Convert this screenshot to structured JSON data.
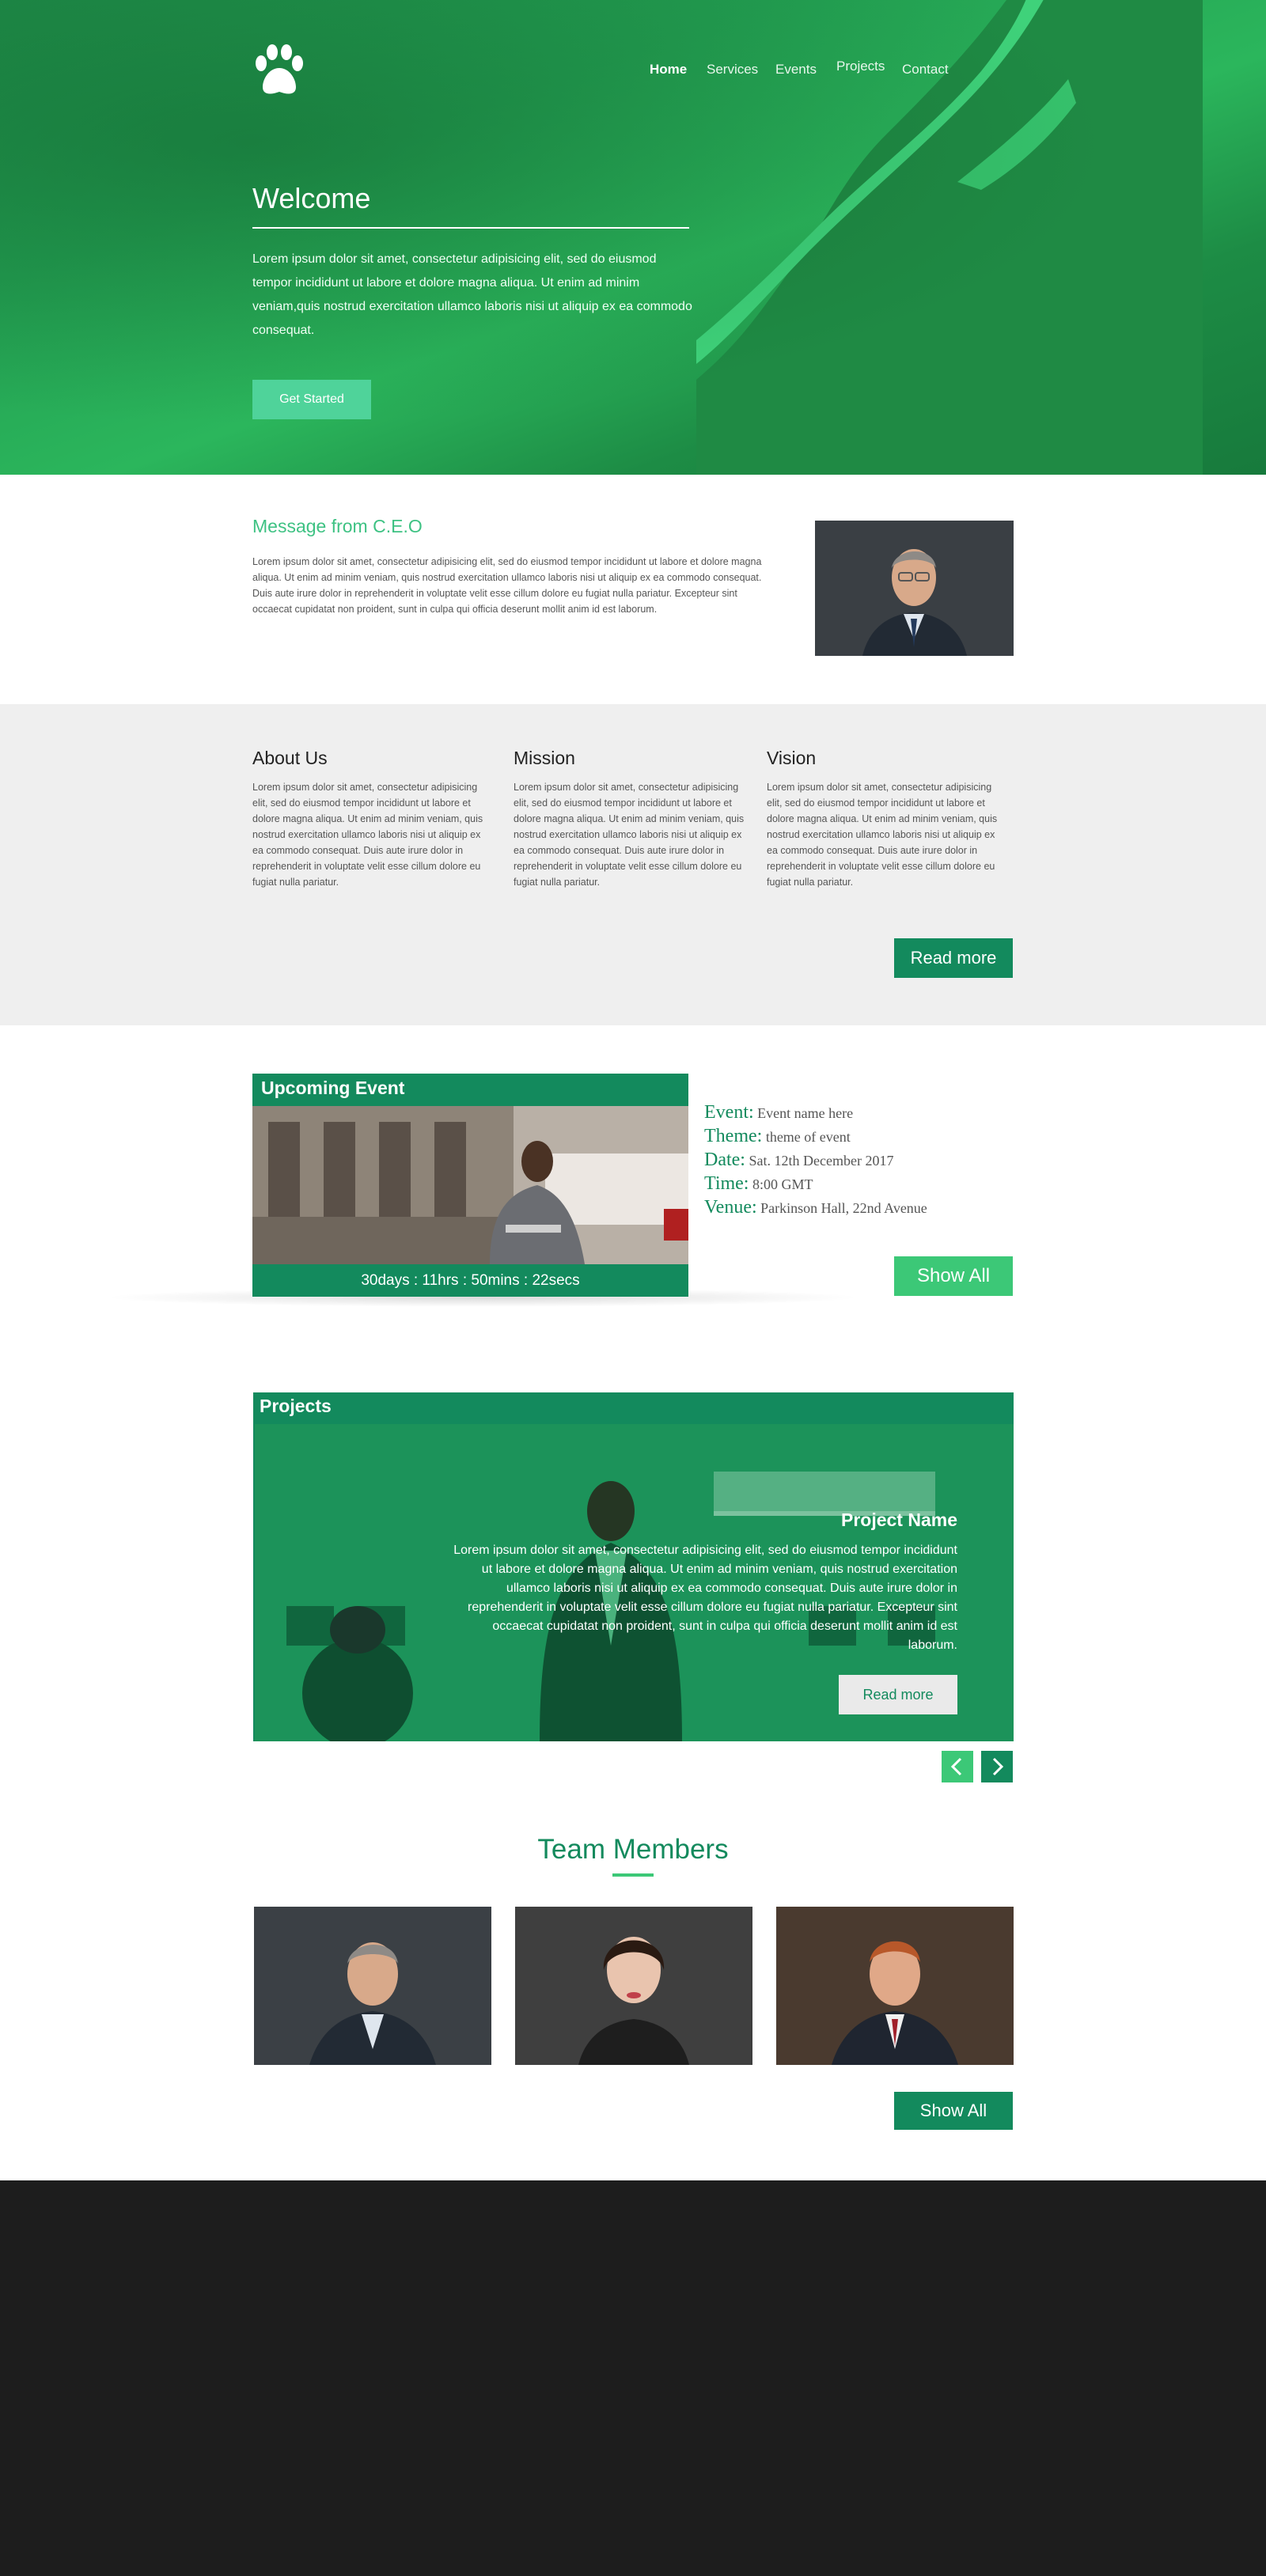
{
  "header": {
    "nav": [
      "Home",
      "Services",
      "Events",
      "Projects",
      "Contact"
    ]
  },
  "hero": {
    "title": "Welcome",
    "text": "Lorem ipsum dolor sit amet, consectetur adipisicing elit, sed do eiusmod tempor incididunt ut labore et dolore magna aliqua. Ut enim ad minim veniam,quis nostrud exercitation ullamco laboris nisi ut aliquip ex ea commodo consequat.",
    "button": "Get Started"
  },
  "ceo": {
    "title": "Message from C.E.O",
    "text": "Lorem ipsum dolor sit amet, consectetur adipisicing elit, sed do eiusmod tempor incididunt ut labore et dolore magna aliqua. Ut enim ad minim veniam, quis nostrud exercitation ullamco laboris nisi ut aliquip ex ea commodo consequat. Duis aute irure dolor in reprehenderit in voluptate velit esse cillum dolore eu fugiat nulla pariatur. Excepteur sint occaecat cupidatat non proident, sunt in culpa qui officia deserunt mollit anim id est laborum."
  },
  "about": {
    "columns": [
      {
        "title": "About Us",
        "text": "Lorem ipsum dolor sit amet, consectetur adipisicing elit, sed do eiusmod tempor incididunt ut labore et dolore magna aliqua. Ut enim ad minim veniam, quis nostrud exercitation ullamco laboris nisi ut aliquip ex ea commodo consequat. Duis aute irure dolor in reprehenderit in voluptate velit esse cillum dolore eu fugiat nulla pariatur."
      },
      {
        "title": "Mission",
        "text": "Lorem ipsum dolor sit amet, consectetur adipisicing elit, sed do eiusmod tempor incididunt ut labore et dolore magna aliqua. Ut enim ad minim veniam, quis nostrud exercitation ullamco laboris nisi ut aliquip ex ea commodo consequat. Duis aute irure dolor in reprehenderit in voluptate velit esse cillum dolore eu fugiat nulla pariatur."
      },
      {
        "title": "Vision",
        "text": "Lorem ipsum dolor sit amet, consectetur adipisicing elit, sed do eiusmod tempor incididunt ut labore et dolore magna aliqua. Ut enim ad minim veniam, quis nostrud exercitation ullamco laboris nisi ut aliquip ex ea commodo consequat. Duis aute irure dolor in reprehenderit in voluptate velit esse cillum dolore eu fugiat nulla pariatur."
      }
    ],
    "button": "Read more"
  },
  "event": {
    "heading": "Upcoming Event",
    "countdown": "30days : 11hrs : 50mins : 22secs",
    "details": [
      {
        "key": "Event:",
        "value": "Event name here"
      },
      {
        "key": "Theme:",
        "value": "theme of event"
      },
      {
        "key": "Date:",
        "value": "Sat. 12th December 2017"
      },
      {
        "key": "Time:",
        "value": "8:00 GMT"
      },
      {
        "key": "Venue:",
        "value": "Parkinson Hall, 22nd Avenue"
      }
    ],
    "button": "Show All"
  },
  "projects": {
    "heading": "Projects",
    "name": "Project Name",
    "text": "Lorem ipsum dolor sit amet, consectetur adipisicing elit, sed do eiusmod tempor incididunt ut labore et dolore magna aliqua. Ut enim ad minim veniam, quis nostrud exercitation ullamco laboris nisi ut aliquip ex ea commodo consequat. Duis aute irure dolor in reprehenderit in voluptate velit esse cillum dolore eu fugiat nulla pariatur. Excepteur sint occaecat cupidatat non proident, sunt in culpa qui officia deserunt mollit anim id est laborum.",
    "button": "Read more"
  },
  "team": {
    "title": "Team Members",
    "button": "Show All"
  },
  "colors": {
    "brand": "#138a5d",
    "accent": "#3cc877",
    "hero": "#23a052",
    "footer": "#1d1d1d"
  }
}
